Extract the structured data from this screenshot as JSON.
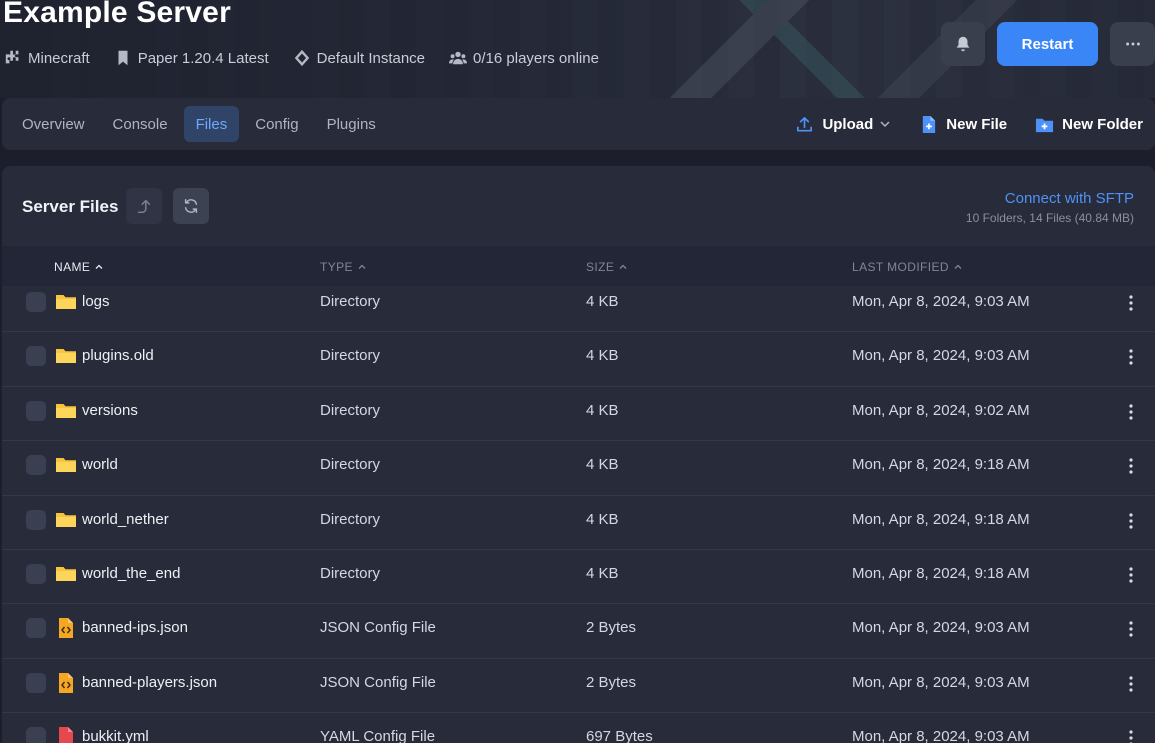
{
  "server": {
    "title": "Example Server",
    "meta": [
      {
        "icon": "puzzle-icon",
        "label": "Minecraft"
      },
      {
        "icon": "bookmark-icon",
        "label": "Paper 1.20.4 Latest"
      },
      {
        "icon": "diamond-icon",
        "label": "Default Instance"
      },
      {
        "icon": "users-icon",
        "label": "0/16 players online"
      }
    ],
    "restart_label": "Restart"
  },
  "tabs": [
    {
      "label": "Overview",
      "active": false
    },
    {
      "label": "Console",
      "active": false
    },
    {
      "label": "Files",
      "active": true
    },
    {
      "label": "Config",
      "active": false
    },
    {
      "label": "Plugins",
      "active": false
    }
  ],
  "actions": {
    "upload": "Upload",
    "new_file": "New File",
    "new_folder": "New Folder"
  },
  "files_panel": {
    "title": "Server Files",
    "sftp_link": "Connect with SFTP",
    "summary": "10 Folders, 14 Files (40.84 MB)",
    "columns": [
      "NAME",
      "TYPE",
      "SIZE",
      "LAST MODIFIED"
    ],
    "rows": [
      {
        "name": "logs",
        "type": "Directory",
        "size": "4 KB",
        "modified": "Mon, Apr 8, 2024, 9:03 AM",
        "icon": "folder-icon"
      },
      {
        "name": "plugins.old",
        "type": "Directory",
        "size": "4 KB",
        "modified": "Mon, Apr 8, 2024, 9:03 AM",
        "icon": "folder-icon"
      },
      {
        "name": "versions",
        "type": "Directory",
        "size": "4 KB",
        "modified": "Mon, Apr 8, 2024, 9:02 AM",
        "icon": "folder-icon"
      },
      {
        "name": "world",
        "type": "Directory",
        "size": "4 KB",
        "modified": "Mon, Apr 8, 2024, 9:18 AM",
        "icon": "folder-icon"
      },
      {
        "name": "world_nether",
        "type": "Directory",
        "size": "4 KB",
        "modified": "Mon, Apr 8, 2024, 9:18 AM",
        "icon": "folder-icon"
      },
      {
        "name": "world_the_end",
        "type": "Directory",
        "size": "4 KB",
        "modified": "Mon, Apr 8, 2024, 9:18 AM",
        "icon": "folder-icon"
      },
      {
        "name": "banned-ips.json",
        "type": "JSON Config File",
        "size": "2 Bytes",
        "modified": "Mon, Apr 8, 2024, 9:03 AM",
        "icon": "json-file-icon"
      },
      {
        "name": "banned-players.json",
        "type": "JSON Config File",
        "size": "2 Bytes",
        "modified": "Mon, Apr 8, 2024, 9:03 AM",
        "icon": "json-file-icon"
      },
      {
        "name": "bukkit.yml",
        "type": "YAML Config File",
        "size": "697 Bytes",
        "modified": "Mon, Apr 8, 2024, 9:03 AM",
        "icon": "yaml-file-icon"
      }
    ]
  },
  "colors": {
    "accent": "#3b86f7",
    "folder": "#f7c53b",
    "json_file": "#f5a623",
    "yaml_file": "#e5484d",
    "background": "#1c1f2b",
    "panel": "#272b3a"
  }
}
